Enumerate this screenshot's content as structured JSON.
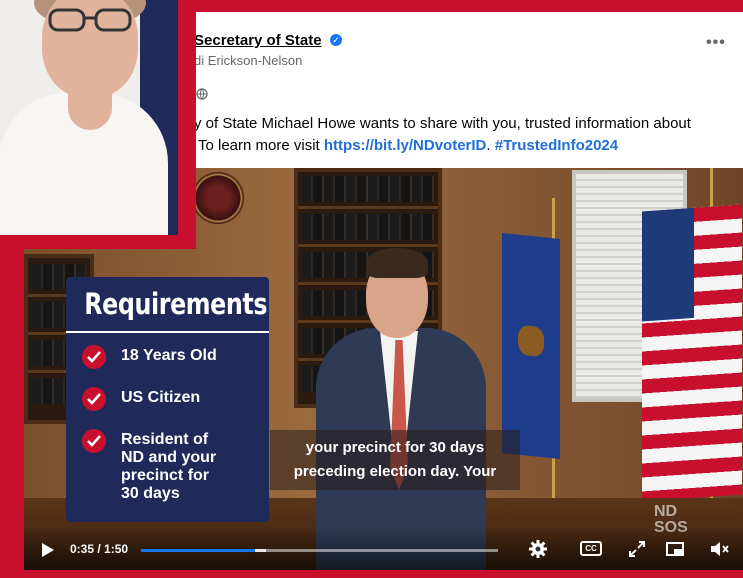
{
  "post": {
    "page_name": "Secretary of State",
    "author": "di Erickson-Nelson",
    "text_line1": "y of State Michael Howe wants to share with you, trusted information about",
    "text_line2_prefix": "To learn more visit ",
    "link": "https://bit.ly/NDvoterID",
    "separator": ". ",
    "hashtag": "#TrustedInfo2024",
    "more_label": "•••"
  },
  "requirements": {
    "title": "Requirements",
    "items": [
      {
        "label": "18 Years Old"
      },
      {
        "label": "US Citizen"
      },
      {
        "label": "Resident of ND and your precinct for 30 days"
      }
    ]
  },
  "caption": {
    "line1": "your precinct for 30 days",
    "line2": "preceding election day. Your"
  },
  "watermark": {
    "line1": "ND",
    "line2": "SOS"
  },
  "player": {
    "time": "0:35 / 1:50",
    "progress": 0.318,
    "buffered": 0.35,
    "cc_label": "CC"
  },
  "colors": {
    "accent_red": "#c8102e",
    "navy": "#1f2a5a",
    "link_blue": "#216fdb",
    "fb_blue": "#1877f2"
  },
  "icons": [
    "verified-icon",
    "globe-icon",
    "check-icon",
    "play-icon",
    "settings-icon",
    "cc-icon",
    "fullscreen-icon",
    "pip-icon",
    "volume-icon"
  ]
}
